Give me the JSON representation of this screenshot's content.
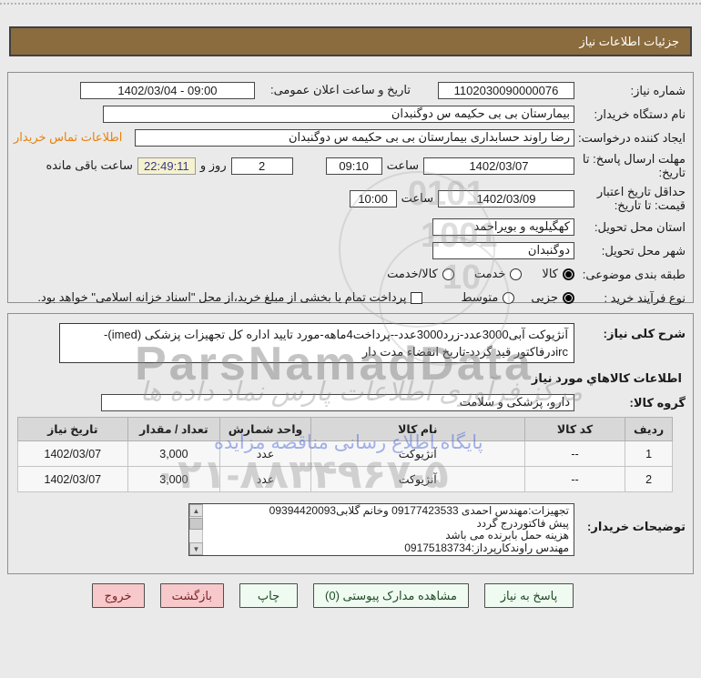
{
  "titlebar": {
    "text": "جزئیات اطلاعات نیاز"
  },
  "form": {
    "need_number": {
      "label": "شماره نیاز:",
      "value": "1102030090000076"
    },
    "announce": {
      "label": "تاریخ و ساعت اعلان عمومی:",
      "value": "1402/03/04 - 09:00"
    },
    "buyer_org": {
      "label": "نام دستگاه خریدار:",
      "value": "بیمارستان بی بی حکیمه س  دوگنبدان"
    },
    "creator": {
      "label": "ایجاد کننده درخواست:",
      "value": "رضا راوند حسابداری بیمارستان بی بی حکیمه س  دوگنبدان",
      "contact_link": "اطلاعات تماس خریدار"
    },
    "reply_deadline": {
      "label": "مهلت ارسال پاسخ: تا تاریخ:",
      "date": "1402/03/07",
      "hour_label": "ساعت",
      "time": "09:10",
      "days": "2",
      "days_label": "روز و",
      "remaining": "22:49:11",
      "remaining_label": "ساعت باقی مانده"
    },
    "price_validity": {
      "label": "حداقل تاریخ اعتبار قیمت: تا تاریخ:",
      "date": "1402/03/09",
      "hour_label": "ساعت",
      "time": "10:00"
    },
    "province": {
      "label": "استان محل تحویل:",
      "value": "کهگیلویه و بویراحمد"
    },
    "city": {
      "label": "شهر محل تحویل:",
      "value": "دوگنبدان"
    },
    "category": {
      "label": "طبقه بندی موضوعی:",
      "options": [
        {
          "label": "کالا",
          "checked": true
        },
        {
          "label": "خدمت",
          "checked": false
        },
        {
          "label": "کالا/خدمت",
          "checked": false
        }
      ]
    },
    "process_type": {
      "label": "نوع فرآیند خرید :",
      "options": [
        {
          "label": "جزیی",
          "checked": true
        },
        {
          "label": "متوسط",
          "checked": false
        }
      ],
      "treasury_label": "پرداخت تمام یا بخشی از مبلغ خرید،از محل \"اسناد خزانه اسلامی\" خواهد بود."
    }
  },
  "need_section": {
    "desc_label": "شرح کلی نیاز:",
    "desc_line1": "آنژیوکت آبی3000عدد-زرد3000عدد--پرداخت4ماهه-مورد تایید اداره کل تجهیزات پزشکی (imed)-",
    "desc_line2": "ircدرفاکتور قید گردد-تاریخ انقضاء مدت دار",
    "items_header": "اطلاعات کالاهاي مورد نیاز",
    "group_label": "گروه کالا:",
    "group_value": "دارو، پزشکی و سلامت"
  },
  "table": {
    "headers": [
      "ردیف",
      "کد کالا",
      "نام کالا",
      "واحد شمارش",
      "تعداد / مقدار",
      "تاریخ نیاز"
    ],
    "rows": [
      {
        "row_no": "1",
        "code": "--",
        "name": "آنژیوکت",
        "unit": "عدد",
        "qty": "3,000",
        "date": "1402/03/07"
      },
      {
        "row_no": "2",
        "code": "--",
        "name": "آنژیوکت",
        "unit": "عدد",
        "qty": "3,000",
        "date": "1402/03/07"
      }
    ]
  },
  "buyer_notes": {
    "label": "توضیحات خریدار:",
    "lines": [
      "تجهیزات:مهندس احمدی 09177423533 وخانم گلابی09394420093",
      "پیش فاکتوردرج گردد",
      "هزینه حمل بابرنده می باشد",
      "مهندس راوندکارپرداز:09175183734"
    ],
    "scroll_up": "▲",
    "scroll_down": "▼"
  },
  "buttons": {
    "reply": "پاسخ به نیاز",
    "attachments": "مشاهده مدارک پیوستی (0)",
    "print": "چاپ",
    "back": "بازگشت",
    "exit": "خروج"
  },
  "watermarks": {
    "brand": "ParsNamadData",
    "calligraphy": "مرکز فرآوری اطلاعات پارس نماد داده ها",
    "blue_line": "پایگاه اطلاع رسانی مناقصه مزایده",
    "phone": "۰۲۱-۸۸۳۴۹۶۷-۵",
    "digits1": "0101",
    "digits2": "1001",
    "digits3": "10"
  },
  "colors": {
    "titlebar_bg": "#8b6c3e",
    "link_orange": "#e8820c",
    "countdown_bg": "#f5f2cf",
    "countdown_text": "#3b3b8f",
    "button_pink": "#f7c9ca",
    "button_green": "#effaf1",
    "table_header_bg": "#d8d8d8"
  }
}
